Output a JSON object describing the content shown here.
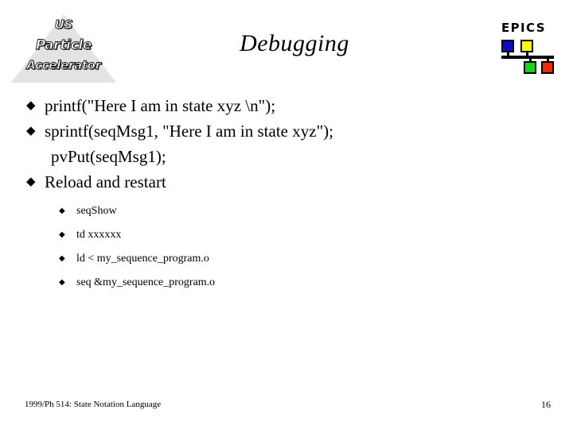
{
  "slide": {
    "title": "Debugging",
    "page_number": "16",
    "footer_text": "1999/Ph 514: State Notation Language",
    "background_color": "#ffffff",
    "text_color": "#000000"
  },
  "logo_upa": {
    "line1": "US",
    "line2": "Particle",
    "line3": "Accelerator",
    "triangle_color": "#e3e3e3"
  },
  "logo_epics": {
    "wordmark": "EPICS",
    "node_colors": {
      "top_left": "#0b0bc8",
      "top_right": "#ffff00",
      "bottom_left": "#13d813",
      "bottom_right": "#ef2a09"
    }
  },
  "body": {
    "bullet_marker": "◆",
    "items": [
      {
        "text": "printf(\"Here I am in state xyz \\n\");",
        "marker": true
      },
      {
        "text": "sprintf(seqMsg1, \"Here I am in state xyz\");",
        "marker": true
      },
      {
        "text": "pvPut(seqMsg1);",
        "marker": false
      },
      {
        "text": "Reload and restart",
        "marker": true
      }
    ]
  },
  "sub_body": {
    "bullet_marker": "◆",
    "items": [
      {
        "text": "seqShow"
      },
      {
        "text": "td xxxxxx"
      },
      {
        "text": "ld < my_sequence_program.o"
      },
      {
        "text": "seq &my_sequence_program.o"
      }
    ]
  }
}
